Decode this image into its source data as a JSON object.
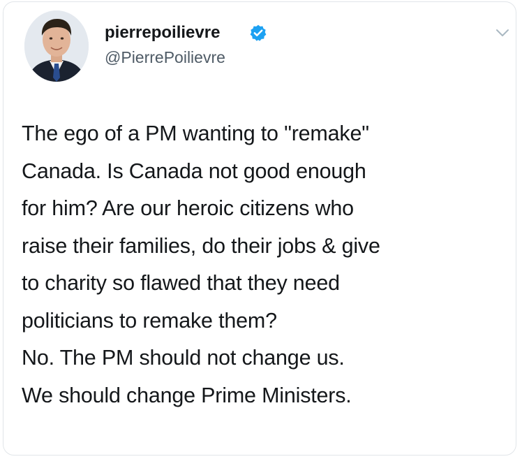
{
  "author": {
    "display_name": "pierrepoilievre",
    "handle": "@PierrePoilievre",
    "verified": true,
    "avatar": "profile-photo"
  },
  "tweet": {
    "lines": [
      "The ego of a PM wanting to \"remake\"",
      "Canada. Is Canada not good enough",
      "for him? Are our heroic citizens who",
      "raise their families, do their jobs & give",
      "to charity so flawed that they need",
      "politicians to remake them?",
      "No. The PM should not change us.",
      "We should change Prime Ministers."
    ]
  },
  "icons": {
    "verified": "verified-badge-icon",
    "more": "chevron-down-icon"
  },
  "colors": {
    "verified_blue": "#1da1f2",
    "text": "#14171a",
    "handle_gray": "#4f5b66",
    "chevron_gray": "#aab8c2"
  }
}
